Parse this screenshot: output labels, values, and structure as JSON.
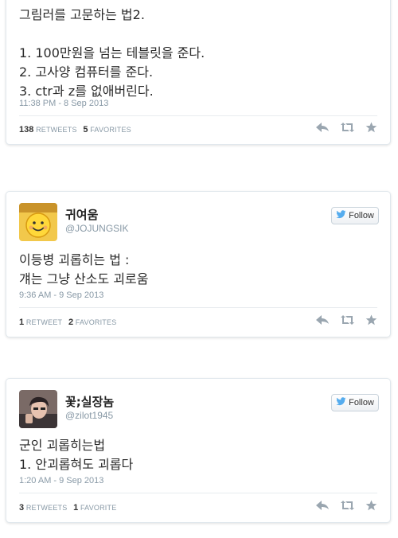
{
  "tweets": [
    {
      "lines": [
        "그림러를 고문하는 법2.",
        "",
        "1. 100만원을 넘는 테블릿을 준다.",
        "2. 고사양 컴퓨터를 준다.",
        "3. ctr과 z를 없애버린다."
      ],
      "time": "11:38 PM - 8 Sep 2013",
      "retweets_count": "138",
      "retweets_label": "RETWEETS",
      "favorites_count": "5",
      "favorites_label": "FAVORITES"
    },
    {
      "name": "귀여움",
      "handle": "@JOJUNGSIK",
      "follow_label": "Follow",
      "lines": [
        "이등병 괴롭히는 법 :",
        "걔는 그냥 산소도 괴로움"
      ],
      "time": "9:36 AM - 9 Sep 2013",
      "retweets_count": "1",
      "retweets_label": "RETWEET",
      "favorites_count": "2",
      "favorites_label": "FAVORITES"
    },
    {
      "name": "꽃;실장놈",
      "handle": "@zilot1945",
      "follow_label": "Follow",
      "lines": [
        "군인 괴롭히는법",
        "1. 안괴롭혀도 괴롭다"
      ],
      "time": "1:20 AM - 9 Sep 2013",
      "retweets_count": "3",
      "retweets_label": "RETWEETS",
      "favorites_count": "1",
      "favorites_label": "FAVORITE"
    }
  ],
  "icons": {
    "reply": "reply-icon",
    "retweet": "retweet-icon",
    "favorite": "star-icon",
    "follow_bird": "twitter-bird-icon"
  },
  "colors": {
    "icon_gray": "#9aa6b0",
    "bird_blue": "#55acee",
    "meta_gray": "#8899a6"
  }
}
